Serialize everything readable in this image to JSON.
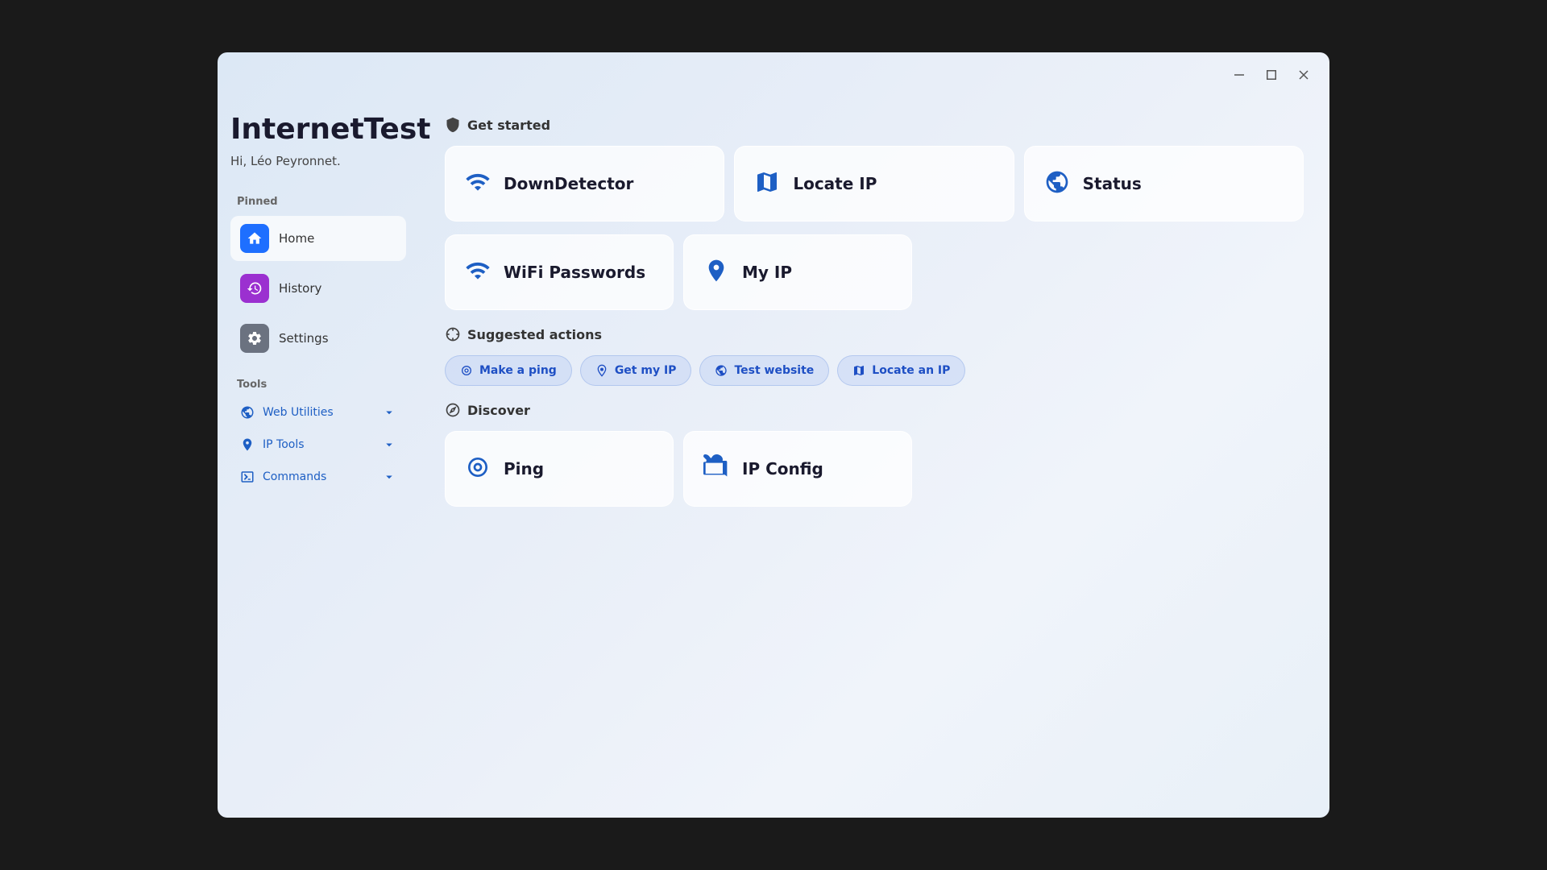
{
  "app": {
    "title": "InternetTest",
    "subtitle": "Hi, Léo Peyronnet.",
    "window_controls": {
      "minimize": "—",
      "maximize": "☐",
      "close": "✕"
    }
  },
  "sidebar": {
    "pinned_label": "Pinned",
    "nav_items": [
      {
        "id": "home",
        "label": "Home",
        "icon": "home",
        "color": "blue",
        "active": true
      },
      {
        "id": "history",
        "label": "History",
        "icon": "history",
        "color": "purple",
        "active": false
      },
      {
        "id": "settings",
        "label": "Settings",
        "icon": "settings",
        "color": "gray",
        "active": false
      }
    ],
    "tools_label": "Tools",
    "tools_items": [
      {
        "id": "web-utilities",
        "label": "Web Utilities",
        "icon": "globe",
        "expanded": true
      },
      {
        "id": "ip-tools",
        "label": "IP Tools",
        "icon": "location",
        "expanded": true
      },
      {
        "id": "commands",
        "label": "Commands",
        "icon": "terminal",
        "expanded": true
      }
    ]
  },
  "main": {
    "get_started": {
      "label": "Get started",
      "cards": [
        {
          "id": "downdetector",
          "label": "DownDetector",
          "icon": "signal"
        },
        {
          "id": "locate-ip",
          "label": "Locate IP",
          "icon": "map"
        },
        {
          "id": "status",
          "label": "Status",
          "icon": "globe-check"
        },
        {
          "id": "wifi-passwords",
          "label": "WiFi Passwords",
          "icon": "wifi"
        },
        {
          "id": "my-ip",
          "label": "My IP",
          "icon": "pin"
        }
      ]
    },
    "suggested_actions": {
      "label": "Suggested actions",
      "chips": [
        {
          "id": "make-ping",
          "label": "Make a ping",
          "icon": "ping"
        },
        {
          "id": "get-my-ip",
          "label": "Get my IP",
          "icon": "pin-dot"
        },
        {
          "id": "test-website",
          "label": "Test website",
          "icon": "globe-dot"
        },
        {
          "id": "locate-an-ip",
          "label": "Locate an IP",
          "icon": "map-dot"
        }
      ]
    },
    "discover": {
      "label": "Discover",
      "cards": [
        {
          "id": "ping",
          "label": "Ping",
          "icon": "ping-waves"
        },
        {
          "id": "ip-config",
          "label": "IP Config",
          "icon": "briefcase"
        }
      ]
    }
  }
}
